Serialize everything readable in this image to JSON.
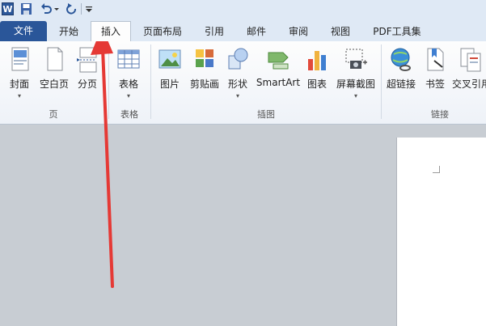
{
  "app": {
    "logo_letter": "W"
  },
  "quick_access": {
    "icons": [
      "save-icon",
      "undo-icon",
      "redo-icon",
      "customize-dropdown-icon"
    ]
  },
  "tabs": [
    {
      "label": "文件"
    },
    {
      "label": "开始"
    },
    {
      "label": "插入"
    },
    {
      "label": "页面布局"
    },
    {
      "label": "引用"
    },
    {
      "label": "邮件"
    },
    {
      "label": "审阅"
    },
    {
      "label": "视图"
    },
    {
      "label": "PDF工具集"
    }
  ],
  "ribbon": {
    "groups": [
      {
        "label": "页"
      },
      {
        "label": "表格"
      },
      {
        "label": "插图"
      },
      {
        "label": "链接"
      }
    ],
    "buttons": [
      {
        "label": "封面",
        "icon": "cover-page-icon",
        "has_dropdown": true
      },
      {
        "label": "空白页",
        "icon": "blank-page-icon"
      },
      {
        "label": "分页",
        "icon": "page-break-icon"
      },
      {
        "label": "表格",
        "icon": "table-icon",
        "has_dropdown": true
      },
      {
        "label": "图片",
        "icon": "picture-icon"
      },
      {
        "label": "剪贴画",
        "icon": "clip-art-icon"
      },
      {
        "label": "形状",
        "icon": "shapes-icon",
        "has_dropdown": true
      },
      {
        "label": "SmartArt",
        "icon": "smartart-icon"
      },
      {
        "label": "图表",
        "icon": "chart-icon"
      },
      {
        "label": "屏幕截图",
        "icon": "screenshot-icon",
        "has_dropdown": true
      },
      {
        "label": "超链接",
        "icon": "hyperlink-icon"
      },
      {
        "label": "书签",
        "icon": "bookmark-icon"
      },
      {
        "label": "交叉引用",
        "icon": "cross-reference-icon"
      }
    ],
    "dropdown_glyph": "▾"
  },
  "annotation": {
    "color": "#e53935"
  }
}
